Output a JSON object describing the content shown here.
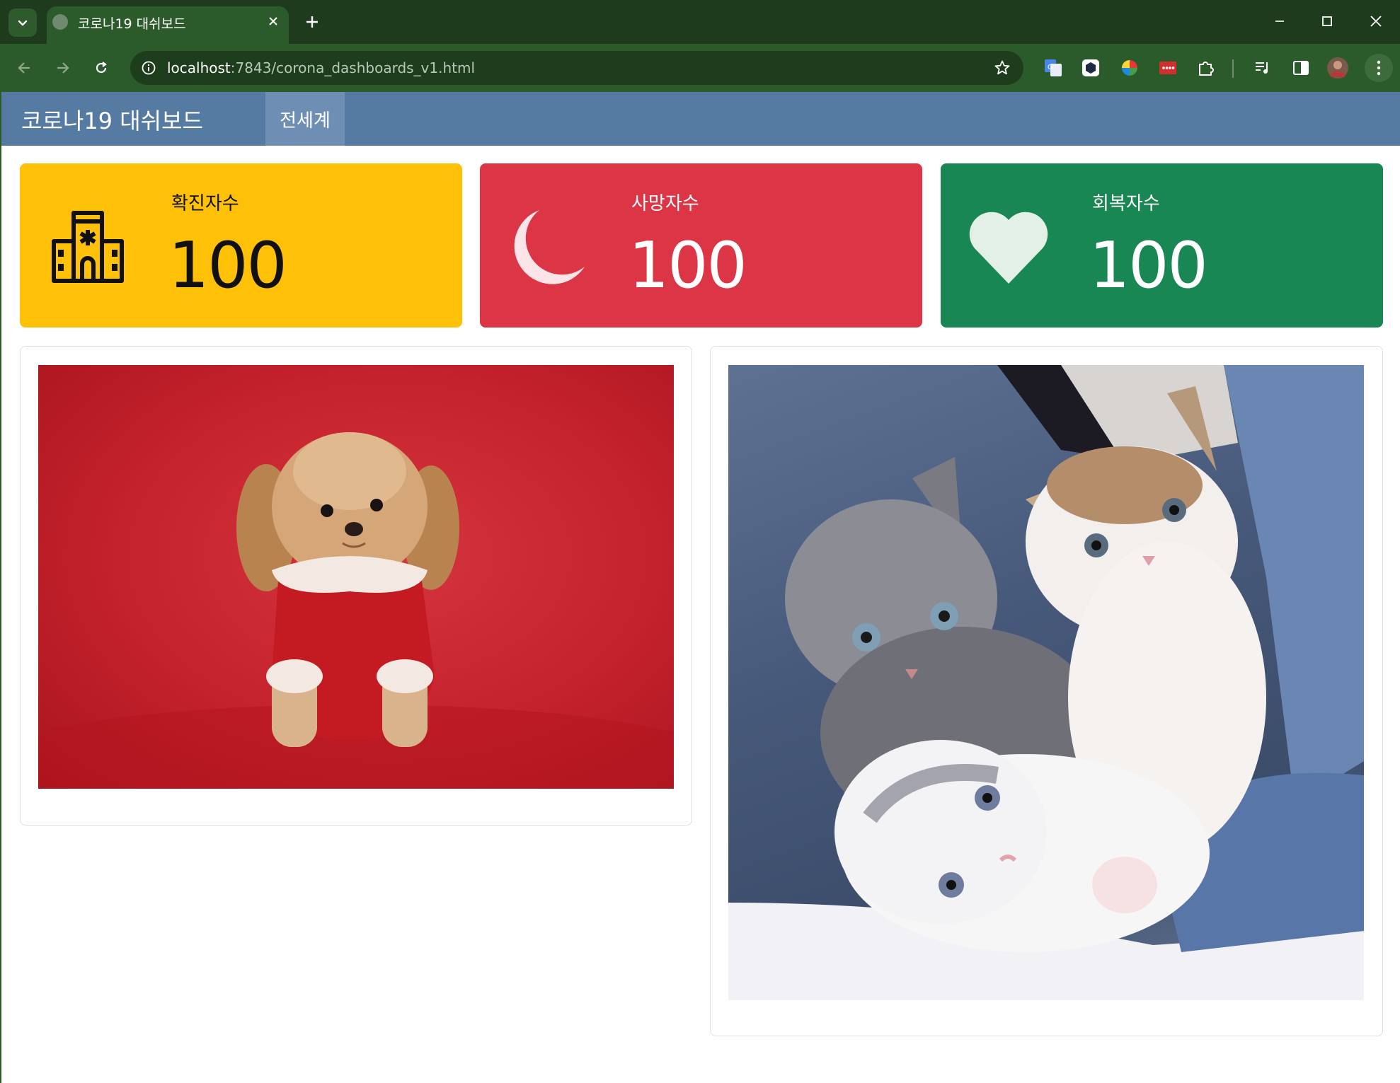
{
  "browser": {
    "tab_title": "코로나19 대쉬보드",
    "url_host": "localhost",
    "url_path": ":7843/corona_dashboards_v1.html"
  },
  "navbar": {
    "brand": "코로나19 대쉬보드",
    "active_item": "전세계"
  },
  "stats": [
    {
      "label": "확진자수",
      "value": "100",
      "icon": "hospital-icon",
      "color": "#ffc107"
    },
    {
      "label": "사망자수",
      "value": "100",
      "icon": "moon-icon",
      "color": "#dc3545"
    },
    {
      "label": "회복자수",
      "value": "100",
      "icon": "heart-icon",
      "color": "#198754"
    }
  ],
  "photos": [
    {
      "subject": "dog"
    },
    {
      "subject": "kittens"
    }
  ]
}
